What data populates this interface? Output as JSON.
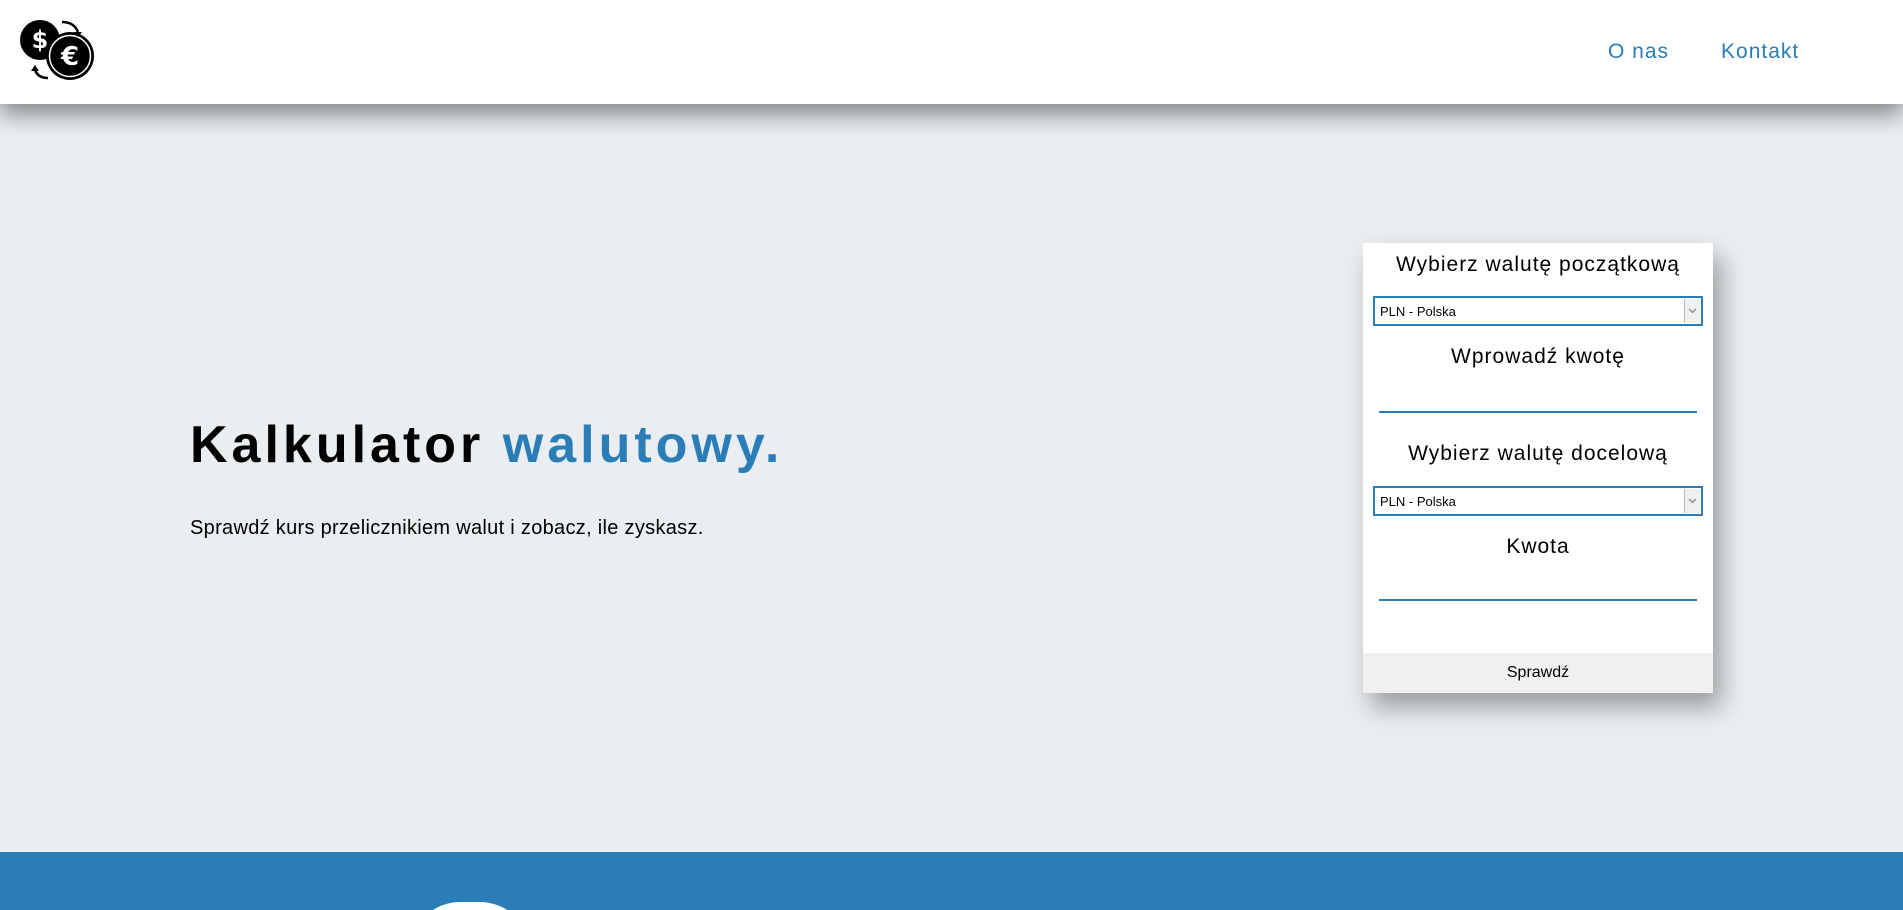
{
  "header": {
    "logo": {
      "icon": "currency-exchange-logo-icon",
      "glyphs": [
        "$",
        "€"
      ]
    },
    "nav": [
      {
        "label": "O nas"
      },
      {
        "label": "Kontakt"
      }
    ]
  },
  "hero": {
    "title_main": "Kalkulator",
    "title_accent": "walutowy.",
    "subtitle": "Sprawdź kurs przelicznikiem walut i zobacz, ile zyskasz."
  },
  "converter": {
    "from_label": "Wybierz walutę początkową",
    "from_value": "PLN - Polska",
    "amount_label": "Wprowadź kwotę",
    "amount_value": "",
    "to_label": "Wybierz walutę docelową",
    "to_value": "PLN - Polska",
    "result_label": "Kwota",
    "result_value": "",
    "submit_label": "Sprawdź"
  },
  "colors": {
    "accent": "#2a7db6",
    "background": "#eaeef0",
    "header_bg": "#ffffff",
    "card_bg": "#ffffff",
    "button_bg": "#f0f0f0"
  }
}
